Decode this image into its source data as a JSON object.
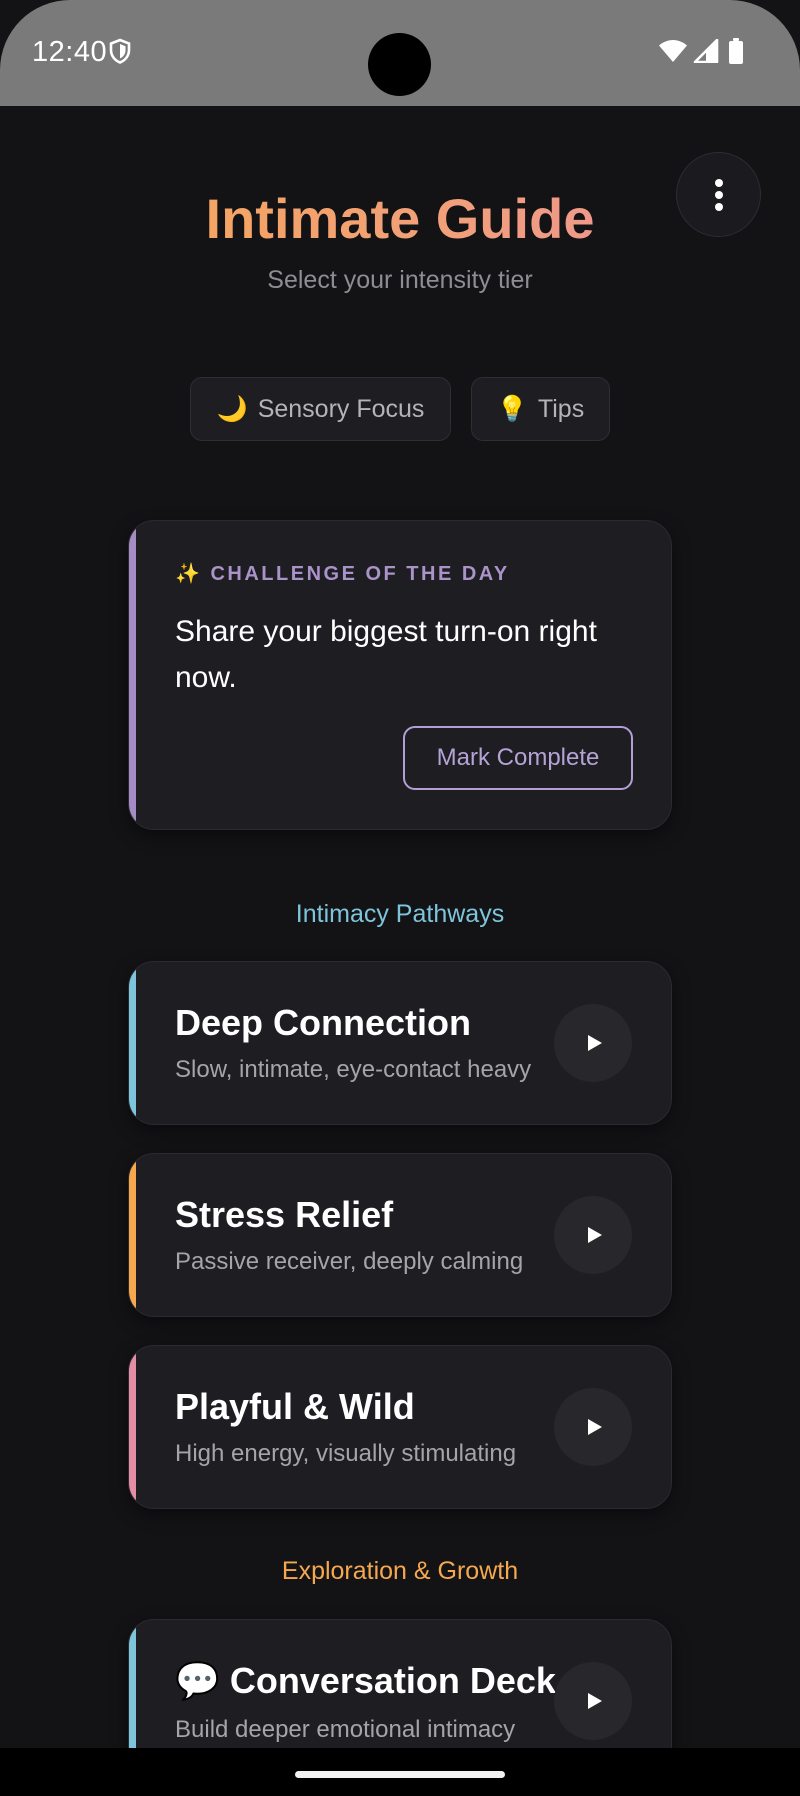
{
  "status_bar": {
    "time": "12:40",
    "icons": [
      "shield-icon",
      "wifi-icon",
      "signal-icon",
      "battery-icon"
    ]
  },
  "header": {
    "title": "Intimate Guide",
    "subtitle": "Select your intensity tier",
    "menu_icon": "more-vert-icon"
  },
  "pills": [
    {
      "emoji": "🌙",
      "label": "Sensory Focus"
    },
    {
      "emoji": "💡",
      "label": "Tips"
    }
  ],
  "challenge": {
    "label": "✨ CHALLENGE OF THE DAY",
    "text": "Share your biggest turn-on right now.",
    "button": "Mark Complete",
    "accent": "#a58cc4"
  },
  "sections": {
    "pathways": "Intimacy Pathways",
    "exploration": "Exploration & Growth"
  },
  "pathways": [
    {
      "title": "Deep Connection",
      "description": "Slow, intimate, eye-contact heavy",
      "accent": "#7ec5dc"
    },
    {
      "title": "Stress Relief",
      "description": "Passive receiver, deeply calming",
      "accent": "#f5a84e"
    },
    {
      "title": "Playful & Wild",
      "description": "High energy, visually stimulating",
      "accent": "#e48ea6"
    }
  ],
  "exploration": [
    {
      "title": "💬 Conversation Deck",
      "description": "Build deeper emotional intimacy",
      "accent": "#7ec5dc"
    }
  ],
  "colors": {
    "background": "#131316",
    "card": "#1d1d22",
    "title_gradient_start": "#f5a84e",
    "title_gradient_end": "#ec8fa0"
  }
}
